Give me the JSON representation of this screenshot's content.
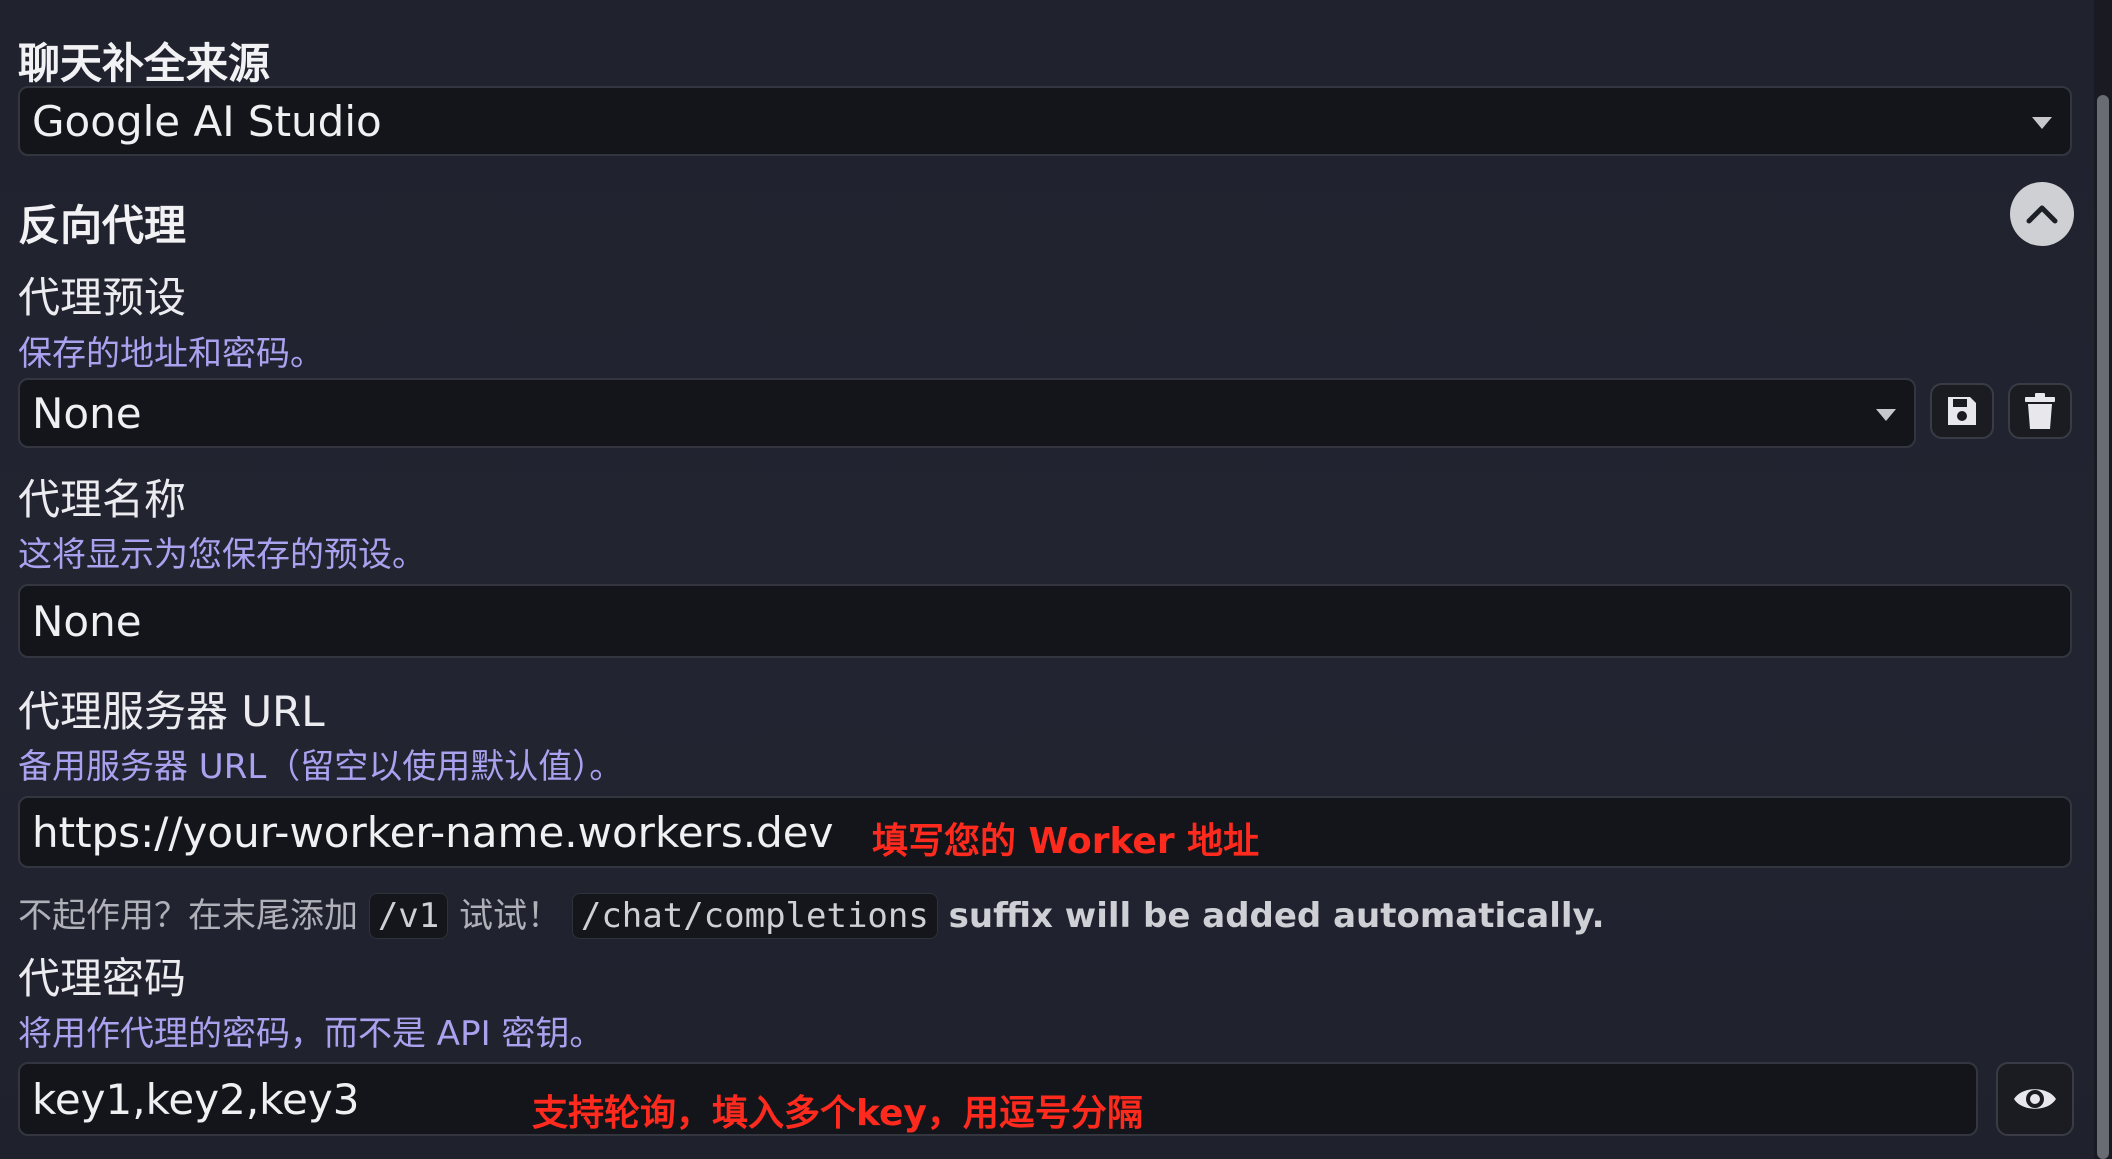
{
  "chat_source": {
    "title": "聊天补全来源",
    "selected": "Google AI Studio"
  },
  "reverse_proxy": {
    "title": "反向代理",
    "toggle_icon": "chevron-up-icon",
    "preset": {
      "label": "代理预设",
      "hint": "保存的地址和密码。",
      "selected": "None",
      "save_icon": "floppy-disk-icon",
      "delete_icon": "trash-icon"
    },
    "name": {
      "label": "代理名称",
      "hint": "这将显示为您保存的预设。",
      "value": "None"
    },
    "url": {
      "label": "代理服务器 URL",
      "hint": "备用服务器 URL（留空以使用默认值）。",
      "value": "https://your-worker-name.workers.dev",
      "annotation": "填写您的 Worker 地址"
    },
    "url_note": {
      "prefix": "不起作用？在末尾添加",
      "code1": "/v1",
      "middle": "试试！",
      "code2": "/chat/completions",
      "suffix": "suffix will be added automatically."
    },
    "password": {
      "label": "代理密码",
      "hint": "将用作代理的密码，而不是 API 密钥。",
      "value": "key1,key2,key3",
      "annotation": "支持轮询，填入多个key，用逗号分隔",
      "reveal_icon": "eye-icon"
    }
  },
  "colors": {
    "background": "#20222e",
    "hint": "#a9a2ef",
    "annotation": "#ff2a1e",
    "field": "#14151a"
  }
}
